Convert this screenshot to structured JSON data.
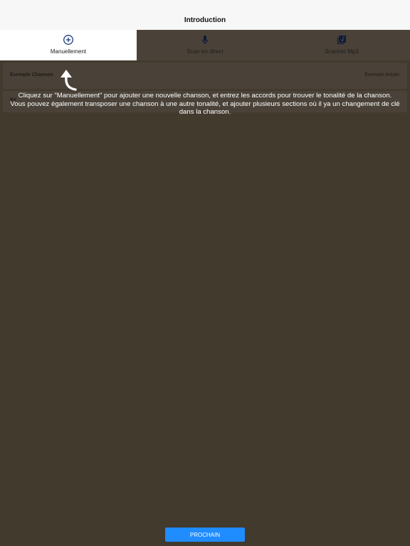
{
  "header": {
    "title": "Introduction"
  },
  "tabs": [
    {
      "label": "Manuellement",
      "icon": "add-circle-icon",
      "active": true
    },
    {
      "label": "Scan en direct",
      "icon": "microphone-icon",
      "active": false
    },
    {
      "label": "Scanner Mp3",
      "icon": "music-library-icon",
      "active": false
    }
  ],
  "song": {
    "name": "Exemple Chanson",
    "artist": "Exemple Artiste",
    "sub": "Ke"
  },
  "overlay": {
    "hint": "Cliquez sur \"Manuellement\" pour ajouter une nouvelle chanson, et entrez les accords pour trouver le tonalité  de la chanson.\nVous pouvez également transposer une chanson à une autre tonalité, et ajouter plusieurs sections où il ya un changement de clé dans la chanson.",
    "next_label": "PROCHAIN"
  },
  "colors": {
    "overlay_bg": "#423a2d",
    "accent": "#1f8cff",
    "icon_blue": "#1d3a7a"
  }
}
